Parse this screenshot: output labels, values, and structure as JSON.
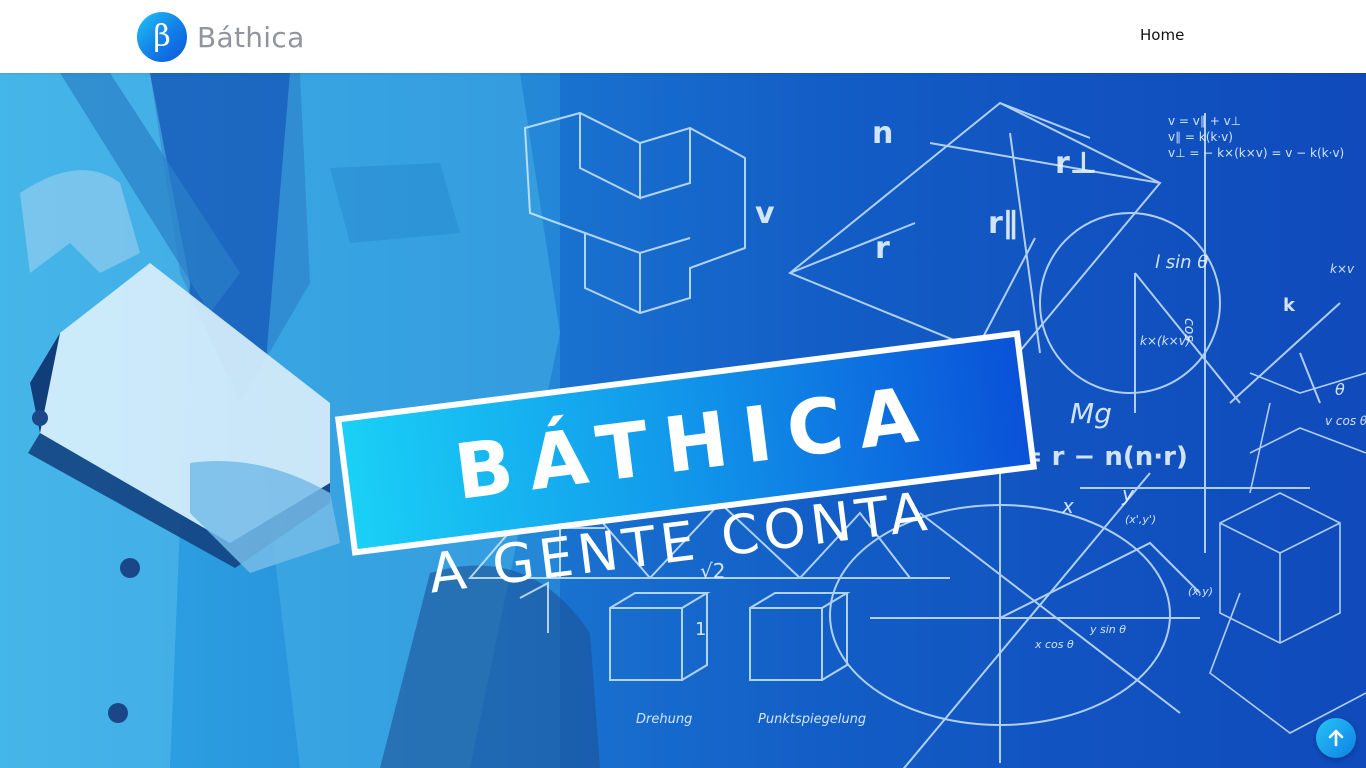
{
  "header": {
    "brand_name": "Báthica",
    "logo_glyph": "β",
    "nav": {
      "home_label": "Home"
    }
  },
  "hero": {
    "title": "BÁTHICA",
    "subtitle": "A GENTE CONTA",
    "chalkboard_text": {
      "eq1": "v = v∥ + v⊥",
      "eq2": "v∥ = k(k·v)",
      "eq3": "v⊥ = − k×(k×v) = v − k(k·v)",
      "n": "n",
      "v": "v",
      "r": "r",
      "r_perp": "r⊥",
      "r_par": "r∥",
      "lsin": "l sin θ",
      "kxkv": "k×(k×v)",
      "kxv": "k×v",
      "k": "k",
      "theta": "θ",
      "mg": "Mg",
      "formula": "n(x·r) = r − n(n·r)",
      "sqrt2": "√2",
      "x": "x",
      "y": "y",
      "drehung": "Drehung",
      "punktspiegelung": "Punktspiegelung",
      "one": "1",
      "cos": "cos",
      "vcos": "v cos θ",
      "xcos": "x cos θ",
      "ysin": "y sin θ",
      "xy1": "(x',y')",
      "xy2": "(x,y)"
    }
  },
  "colors": {
    "brand_blue": "#137ee8",
    "brand_cyan": "#1fc3f5",
    "brand_gray": "#8f959d",
    "hero_dark": "#1150c2"
  },
  "icons": {
    "scroll_top": "arrow-up-icon",
    "logo": "beta-logo-icon"
  }
}
